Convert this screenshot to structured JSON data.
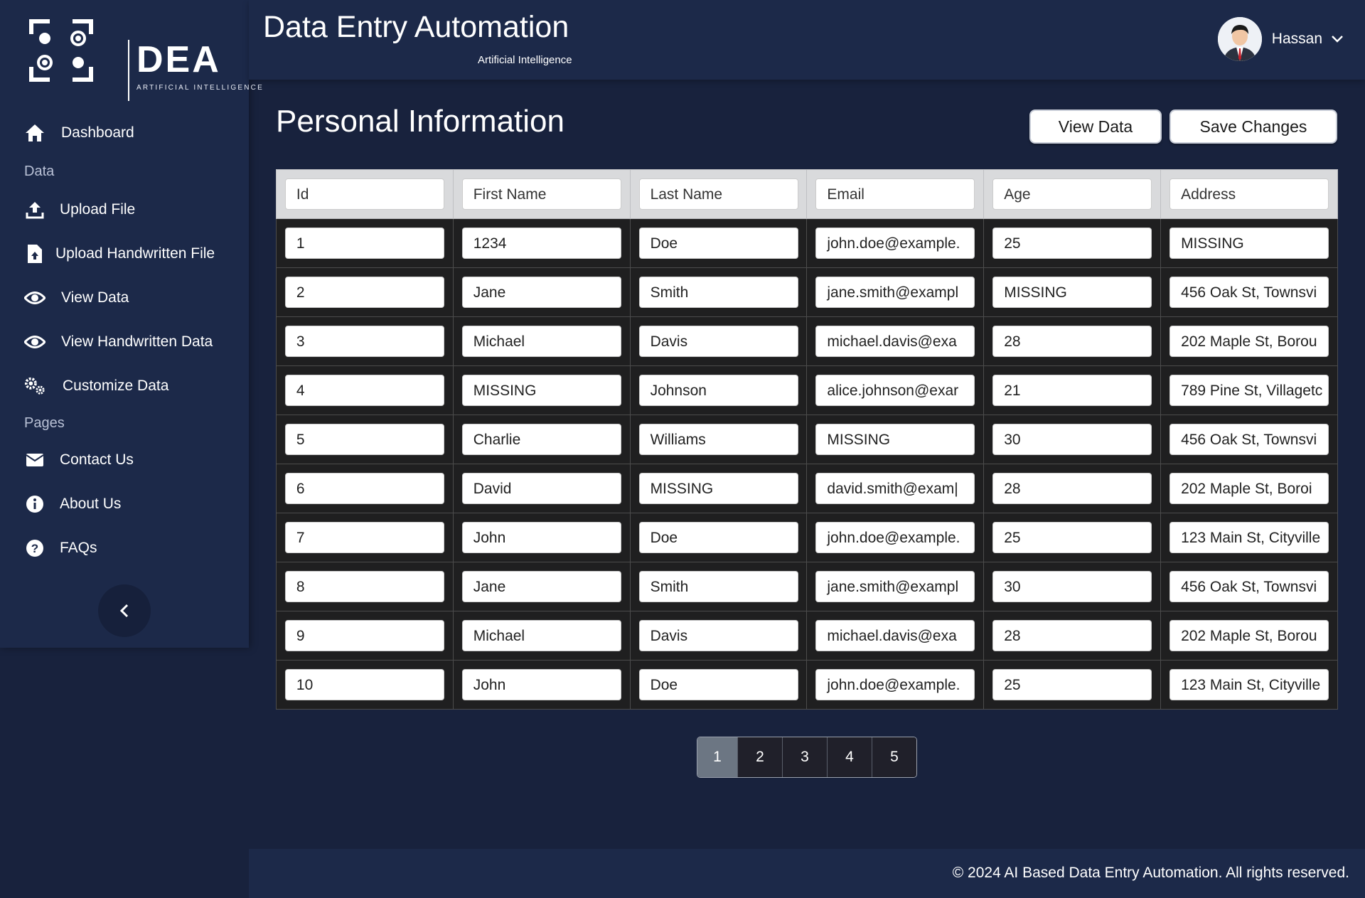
{
  "brand": {
    "logo_text": "DEA",
    "logo_sub": "ARTIFICIAL INTELLIGENCE"
  },
  "header": {
    "title": "Data Entry Automation",
    "subtitle": "Artificial Intelligence",
    "user_name": "Hassan"
  },
  "sidebar": {
    "dashboard": "Dashboard",
    "section_data": "Data",
    "upload_file": "Upload File",
    "upload_handwritten": "Upload Handwritten File",
    "view_data": "View Data",
    "view_handwritten": "View Handwritten Data",
    "customize_data": "Customize Data",
    "section_pages": "Pages",
    "contact_us": "Contact Us",
    "about_us": "About Us",
    "faqs": "FAQs"
  },
  "main": {
    "page_title": "Personal Information",
    "view_data_button": "View Data",
    "save_changes_button": "Save Changes"
  },
  "table": {
    "headers": [
      "Id",
      "First Name",
      "Last Name",
      "Email",
      "Age",
      "Address"
    ],
    "rows": [
      [
        "1",
        "1234",
        "Doe",
        "john.doe@example.",
        "25",
        "MISSING"
      ],
      [
        "2",
        "Jane",
        "Smith",
        "jane.smith@exampl",
        "MISSING",
        "456 Oak St, Townsvi"
      ],
      [
        "3",
        "Michael",
        "Davis",
        "michael.davis@exa",
        "28",
        "202 Maple St, Borou"
      ],
      [
        "4",
        "MISSING",
        "Johnson",
        "alice.johnson@exar",
        "21",
        "789 Pine St, Villagetc"
      ],
      [
        "5",
        "Charlie",
        "Williams",
        "MISSING",
        "30",
        "456 Oak St, Townsvi"
      ],
      [
        "6",
        "David",
        "MISSING",
        "david.smith@exam|",
        "28",
        "202 Maple St, Boroi"
      ],
      [
        "7",
        "John",
        "Doe",
        "john.doe@example.",
        "25",
        "123 Main St, Cityville"
      ],
      [
        "8",
        "Jane",
        "Smith",
        "jane.smith@exampl",
        "30",
        "456 Oak St, Townsvi"
      ],
      [
        "9",
        "Michael",
        "Davis",
        "michael.davis@exa",
        "28",
        "202 Maple St, Borou"
      ],
      [
        "10",
        "John",
        "Doe",
        "john.doe@example.",
        "25",
        "123 Main St, Cityville"
      ]
    ]
  },
  "pagination": {
    "pages": [
      "1",
      "2",
      "3",
      "4",
      "5"
    ],
    "current": "1"
  },
  "footer": {
    "text": "© 2024 AI Based Data Entry Automation. All rights reserved."
  },
  "colors": {
    "background": "#18223d",
    "panel": "#1c2949",
    "table_body": "#1f1f20",
    "table_header": "#d9dadc",
    "active_page": "#6c7683"
  }
}
